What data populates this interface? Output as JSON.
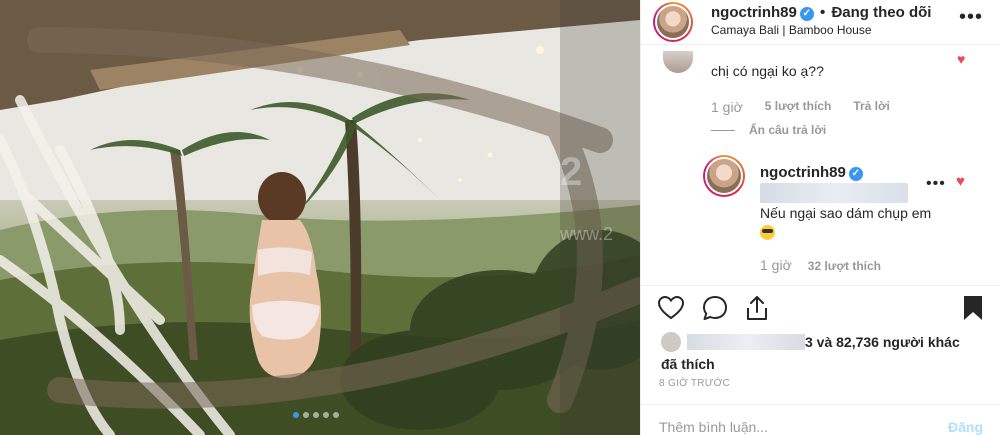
{
  "header": {
    "username": "ngoctrinh89",
    "separator": "•",
    "follow_status": "Đang theo dõi",
    "location": "Camaya Bali | Bamboo House",
    "more_icon": "ellipsis-icon"
  },
  "comments": {
    "first": {
      "text": "chị có ngại ko ạ??",
      "time": "1 giờ",
      "likes": "5 lượt thích",
      "reply": "Trả lời"
    },
    "hide_replies": "Ẩn câu trả lời",
    "reply": {
      "username": "ngoctrinh89",
      "text": "Nếu ngại sao dám chụp em",
      "time": "1 giờ",
      "likes": "32 lượt thích"
    }
  },
  "likes_summary": {
    "suffix": "3 và 82,736 người khác",
    "second_line": "đã thích"
  },
  "post_time": "8 GIỜ TRƯỚC",
  "comment_box": {
    "placeholder": "Thêm bình luận...",
    "post_label": "Đăng"
  },
  "carousel": {
    "count": 5,
    "active": 0
  },
  "colors": {
    "verified": "#3897f0",
    "heart": "#ed4956",
    "post_disabled": "#b2dffc"
  }
}
